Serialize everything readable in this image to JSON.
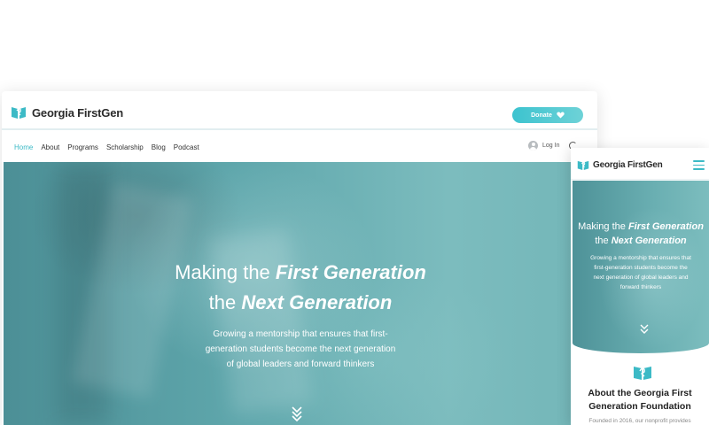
{
  "brand": {
    "name": "Georgia FirstGen",
    "accent": "#3cbac6",
    "hero_teal": "#5fa7ac"
  },
  "desktop": {
    "donate_label": "Donate",
    "nav": {
      "items": [
        {
          "label": "Home",
          "active": true
        },
        {
          "label": "About",
          "active": false
        },
        {
          "label": "Programs",
          "active": false
        },
        {
          "label": "Scholarship",
          "active": false
        },
        {
          "label": "Blog",
          "active": false
        },
        {
          "label": "Podcast",
          "active": false
        }
      ],
      "login_label": "Log In"
    },
    "hero": {
      "title_line1_plain": "Making the ",
      "title_line1_bold": "First Generation",
      "title_line2_plain": "the ",
      "title_line2_bold": "Next Generation",
      "subtitle_lines": [
        "Growing a mentorship that ensures that first-",
        "generation students become the next generation",
        "of global leaders and forward thinkers"
      ]
    }
  },
  "mobile": {
    "hero": {
      "title_line1_plain": "Making the ",
      "title_line1_bold": "First Generation",
      "title_line2_plain": "the ",
      "title_line2_bold": "Next Generation",
      "subtitle_lines": [
        "Growing a mentorship that ensures that",
        "first-generation students become the",
        "next generation of global leaders and",
        "forward thinkers"
      ]
    },
    "about": {
      "title_line1": "About the Georgia First",
      "title_line2": "Generation Foundation",
      "text_partial": "Founded in 2016, our nonprofit provides"
    }
  }
}
